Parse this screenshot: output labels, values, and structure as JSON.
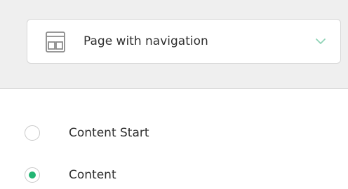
{
  "layout_select": {
    "icon": "layout-page-icon",
    "value": "Page with navigation",
    "chevron_icon": "chevron-down-icon",
    "chevron_color": "#8fd3b6"
  },
  "radio_options": [
    {
      "label": "Content Start",
      "checked": false
    },
    {
      "label": "Content",
      "checked": true
    }
  ],
  "colors": {
    "accent": "#22b573",
    "header_bg": "#efefef"
  }
}
